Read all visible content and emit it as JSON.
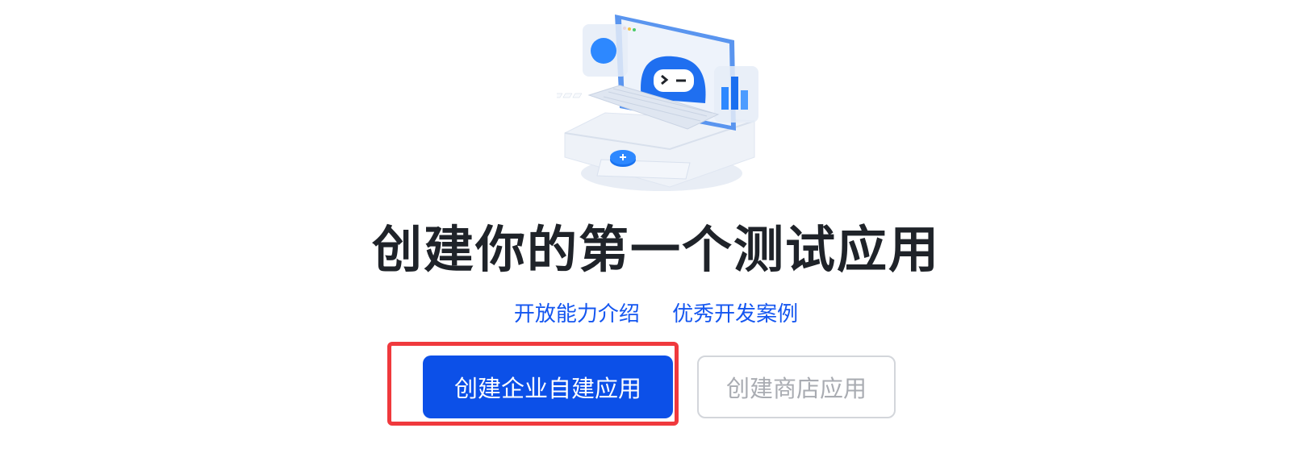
{
  "title": "创建你的第一个测试应用",
  "links": {
    "intro": "开放能力介绍",
    "cases": "优秀开发案例"
  },
  "buttons": {
    "create_enterprise": "创建企业自建应用",
    "create_store": "创建商店应用"
  },
  "colors": {
    "primary": "#0c50e8",
    "link": "#1456f0",
    "highlight": "#f0393d",
    "title": "#1f2329"
  }
}
